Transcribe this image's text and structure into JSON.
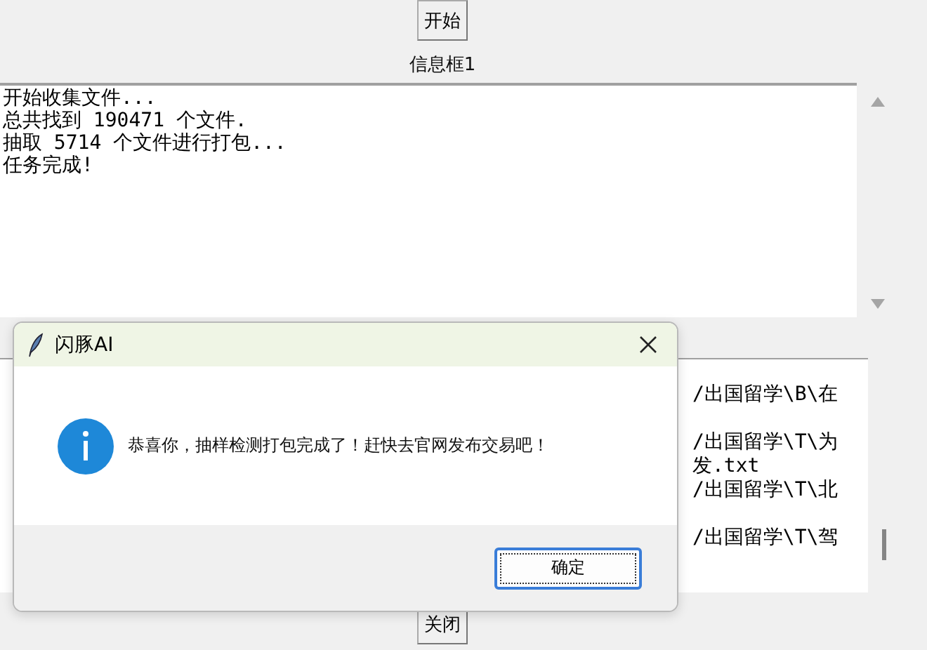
{
  "start_button": "开始",
  "box1": {
    "label": "信息框1",
    "lines": [
      "开始收集文件...",
      "总共找到 190471 个文件.",
      "抽取 5714 个文件进行打包...",
      "任务完成!"
    ]
  },
  "box2": {
    "lines": [
      {
        "kind": "text",
        "text": "/出国留学\\B\\在"
      },
      {
        "kind": "blank"
      },
      {
        "kind": "text",
        "text": "/出国留学\\T\\为"
      },
      {
        "kind": "text",
        "text": "发.txt"
      },
      {
        "kind": "text",
        "text": "/出国留学\\T\\北"
      },
      {
        "kind": "blank"
      },
      {
        "kind": "text",
        "text": "/出国留学\\T\\驾"
      }
    ]
  },
  "close_button": "关闭",
  "dialog": {
    "title": "闪豚AI",
    "message": "恭喜你，抽样检测打包完成了！赶快去官网发布交易吧！",
    "ok_button": "确定"
  }
}
